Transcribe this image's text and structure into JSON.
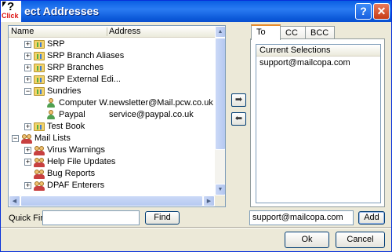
{
  "window": {
    "title": "ect Addresses",
    "help_label": "?",
    "close_label": "✕",
    "logo_mark": "?",
    "logo_text": "Click"
  },
  "tree": {
    "columns": [
      "Name",
      "Address"
    ],
    "rows": [
      {
        "label": "SRP",
        "address": ""
      },
      {
        "label": "SRP Branch Aliases",
        "address": ""
      },
      {
        "label": "SRP Branches",
        "address": ""
      },
      {
        "label": "SRP External Edi...",
        "address": ""
      },
      {
        "label": "Sundries",
        "address": ""
      },
      {
        "label": "Computer W...",
        "address": "newsletter@Mail.pcw.co.uk"
      },
      {
        "label": "Paypal",
        "address": "service@paypal.co.uk"
      },
      {
        "label": "Test Book",
        "address": ""
      },
      {
        "label": "Mail Lists",
        "address": ""
      },
      {
        "label": "Virus Warnings",
        "address": ""
      },
      {
        "label": "Help File Updates",
        "address": ""
      },
      {
        "label": "Bug Reports",
        "address": ""
      },
      {
        "label": "DPAF Enterers",
        "address": ""
      }
    ]
  },
  "tabs": [
    "To",
    "CC",
    "BCC"
  ],
  "selections": {
    "header": "Current Selections",
    "items": [
      "support@mailcopa.com"
    ]
  },
  "quick_find": {
    "label": "Quick Find:",
    "value": "",
    "button": "Find"
  },
  "add": {
    "value": "support@mailcopa.com",
    "button": "Add"
  },
  "footer": {
    "ok": "Ok",
    "cancel": "Cancel"
  },
  "icons": {
    "add_arrow": "right-arrow-icon",
    "remove_arrow": "left-arrow-icon"
  }
}
